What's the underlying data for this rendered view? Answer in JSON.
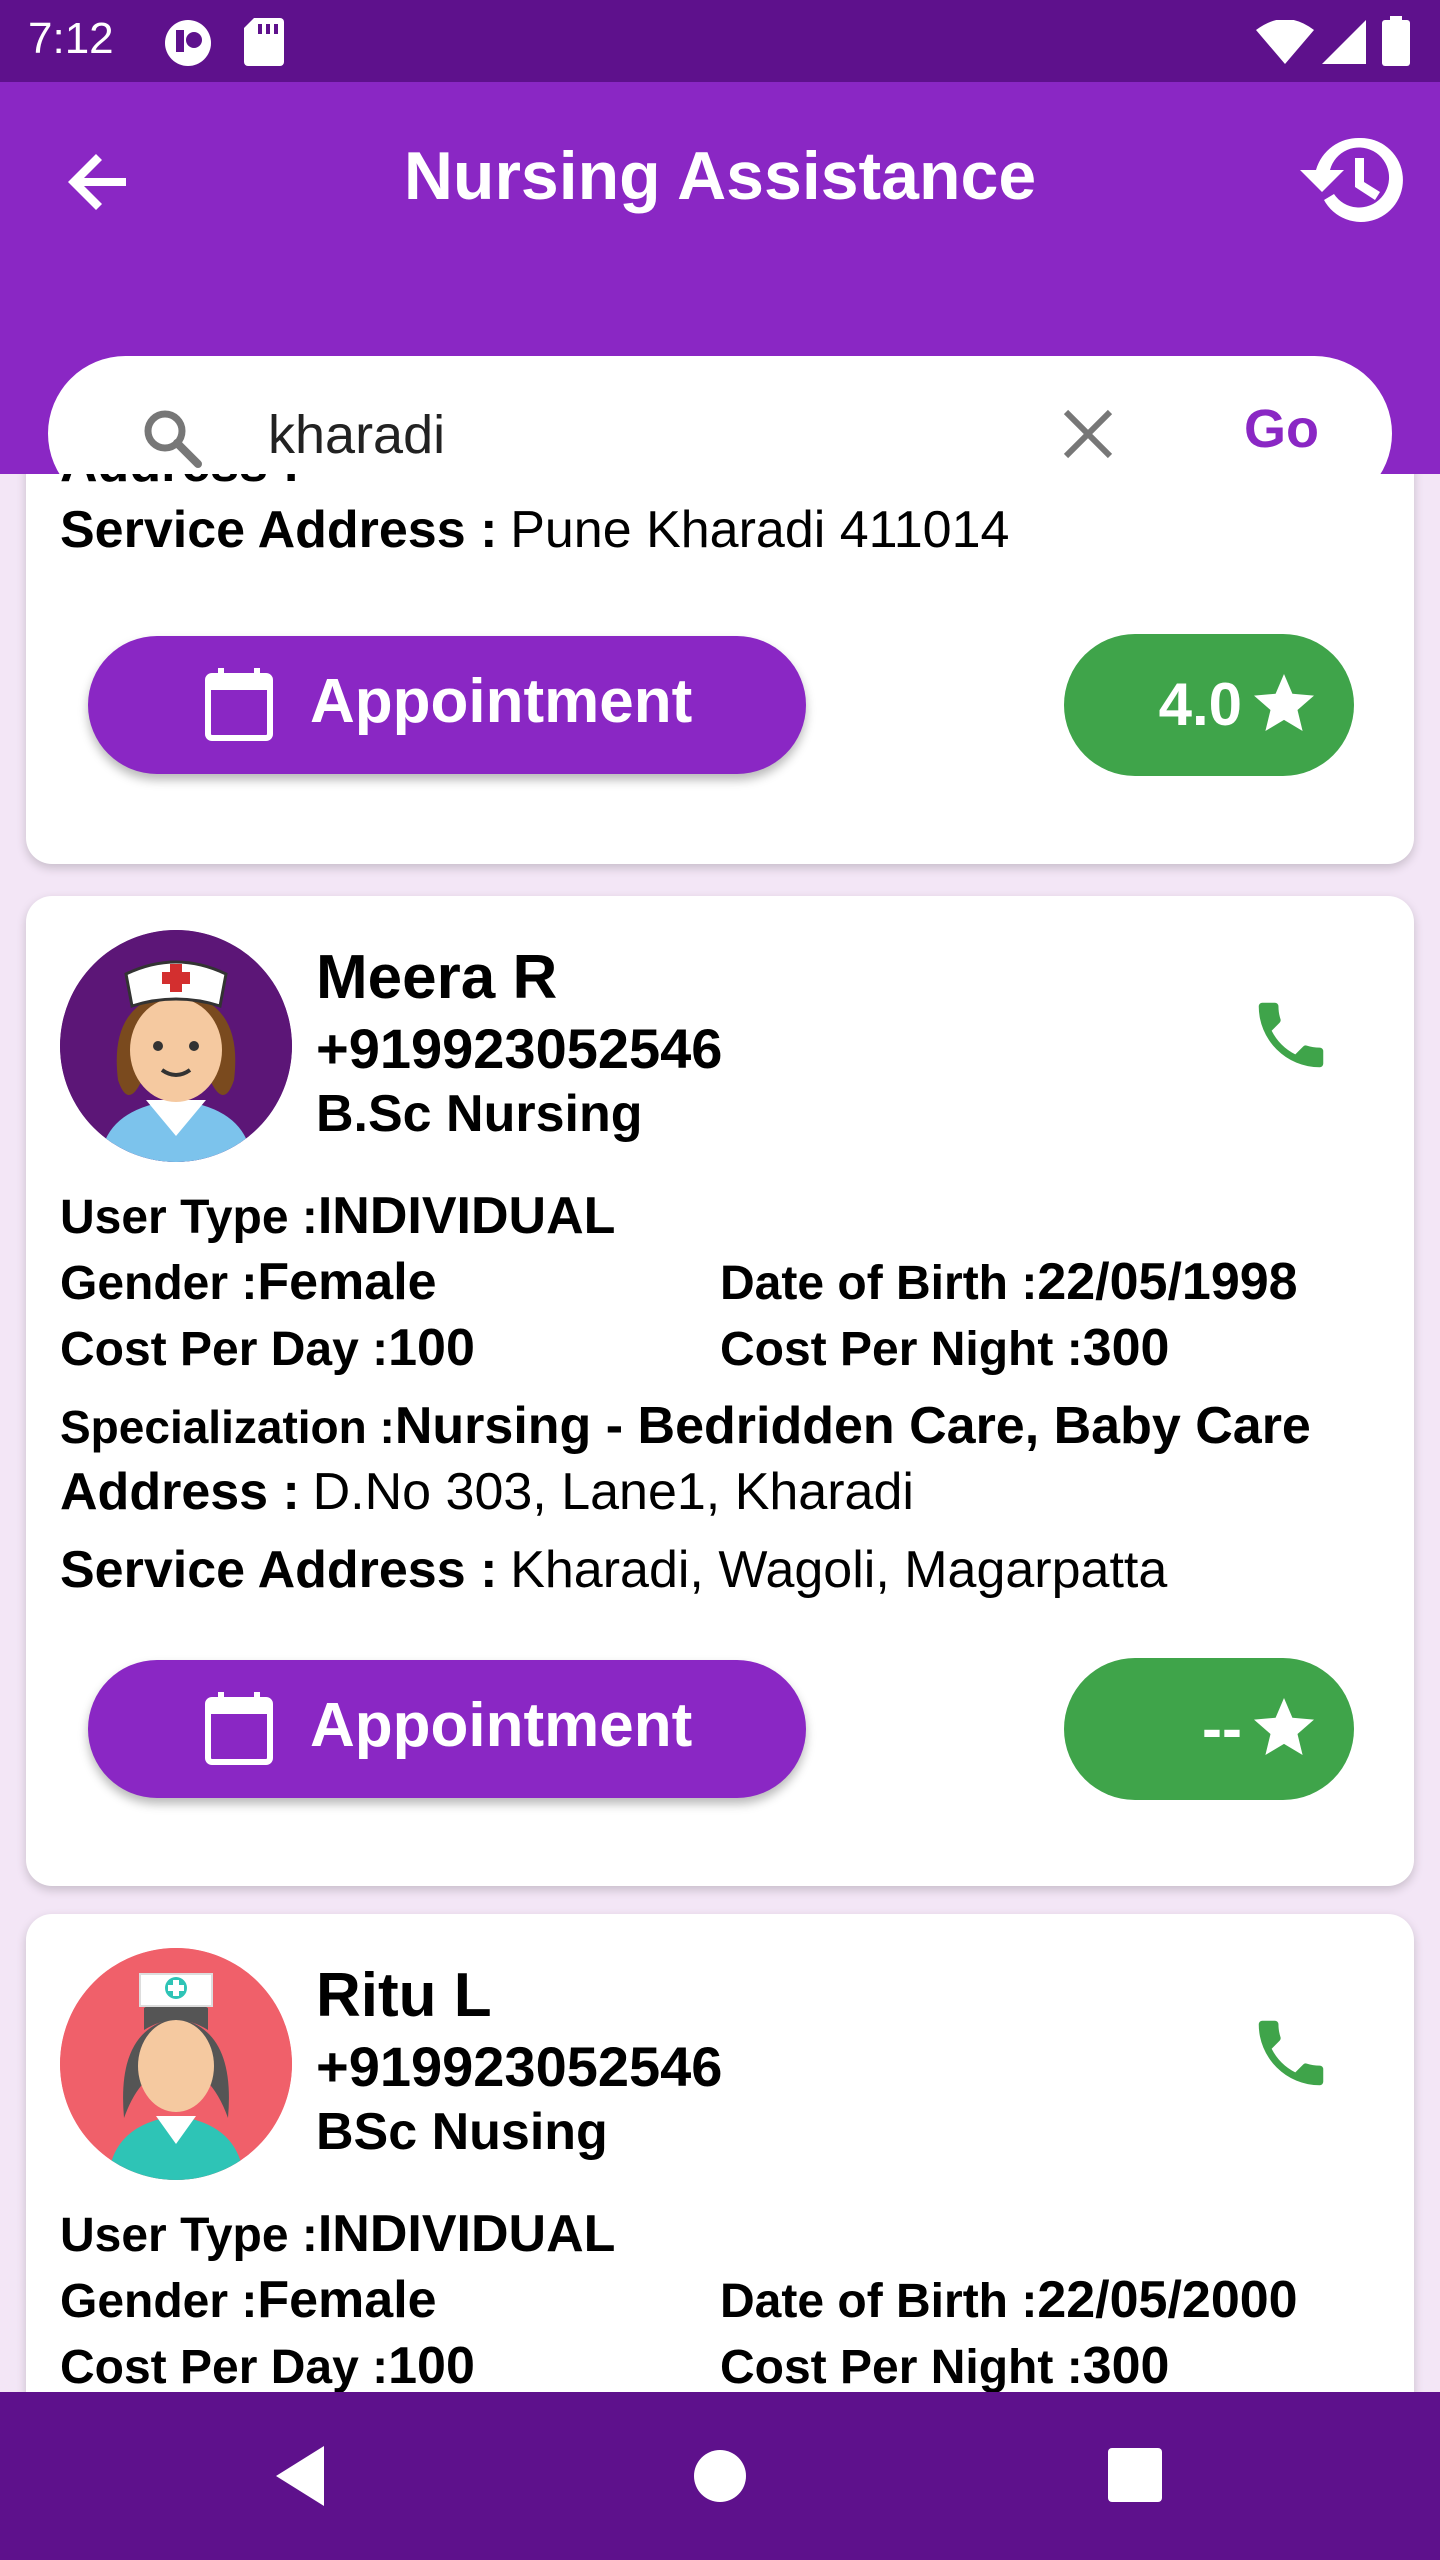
{
  "status_bar": {
    "time": "7:12"
  },
  "app_bar": {
    "title": "Nursing Assistance"
  },
  "search": {
    "value": "kharadi",
    "go_label": "Go"
  },
  "cards": [
    {
      "address_label": "Address :",
      "service_address_label": "Service Address :",
      "service_address": "Pune Kharadi 411014",
      "appointment_label": "Appointment",
      "rating": "4.0"
    },
    {
      "name": "Meera R",
      "phone": "+919923052546",
      "qualification": "B.Sc Nursing",
      "user_type_label": "User Type :",
      "user_type": "INDIVIDUAL",
      "gender_label": "Gender :",
      "gender": "Female",
      "dob_label": "Date of Birth :",
      "dob": "22/05/1998",
      "cost_day_label": "Cost Per Day :",
      "cost_day": "100",
      "cost_night_label": "Cost Per Night :",
      "cost_night": "300",
      "specialization_label": "Specialization :",
      "specialization": "Nursing - Bedridden Care, Baby Care",
      "address_label": "Address :",
      "address": "D.No 303, Lane1, Kharadi",
      "service_address_label": "Service Address :",
      "service_address": "Kharadi, Wagoli, Magarpatta",
      "appointment_label": "Appointment",
      "rating": "--"
    },
    {
      "name": "Ritu L",
      "phone": "+919923052546",
      "qualification": "BSc Nusing",
      "user_type_label": "User Type :",
      "user_type": "INDIVIDUAL",
      "gender_label": "Gender :",
      "gender": "Female",
      "dob_label": "Date of Birth :",
      "dob": "22/05/2000",
      "cost_day_label": "Cost Per Day :",
      "cost_day": "100",
      "cost_night_label": "Cost Per Night :",
      "cost_night": "300"
    }
  ],
  "colors": {
    "primary": "#8a27c4",
    "dark_primary": "#5e118c",
    "rating_green": "#3fa44a",
    "call_green": "#3fa44a"
  },
  "icons": [
    "back-arrow-icon",
    "history-icon",
    "search-icon",
    "clear-icon",
    "calendar-icon",
    "star-icon",
    "phone-icon",
    "nurse-avatar-icon",
    "wifi-icon",
    "signal-icon",
    "battery-icon",
    "nav-back-icon",
    "nav-home-icon",
    "nav-recents-icon"
  ]
}
